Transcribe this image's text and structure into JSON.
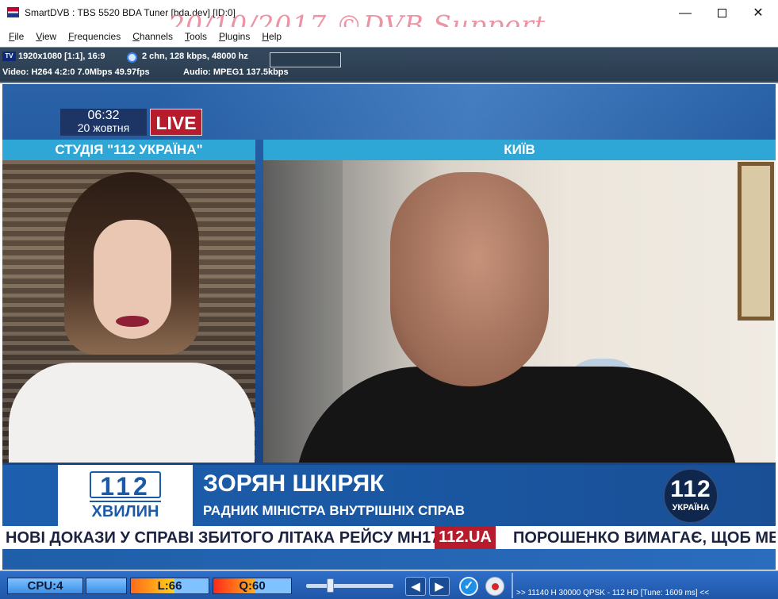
{
  "window": {
    "title": "SmartDVB : TBS 5520 BDA Tuner [bda.dev]  [ID:0]",
    "minimize": "—",
    "maximize": "",
    "close": "✕"
  },
  "watermark": "20/10/2017  ©DVB Support",
  "menu": [
    {
      "underline": "F",
      "rest": "ile"
    },
    {
      "underline": "V",
      "rest": "iew"
    },
    {
      "underline": "F",
      "rest": "requencies"
    },
    {
      "underline": "C",
      "rest": "hannels"
    },
    {
      "underline": "T",
      "rest": "ools"
    },
    {
      "underline": "P",
      "rest": "lugins"
    },
    {
      "underline": "H",
      "rest": "elp"
    }
  ],
  "info": {
    "tv_badge": "TV",
    "resolution": "1920x1080 [1:1], 16:9",
    "audio_summary": "2 chn, 128 kbps, 48000 hz",
    "video_line": "Video: H264  4:2:0  7.0Mbps  49.97fps",
    "audio_line": "Audio: MPEG1  137.5kbps"
  },
  "broadcast": {
    "clock_time": "06:32",
    "clock_date": "20 жовтня",
    "live": "LIVE",
    "studio_label": "СТУДІЯ \"112 УКРАЇНА\"",
    "kyiv_label": "КИЇВ",
    "logo_number": "112",
    "logo_word": "ХВИЛИН",
    "guest_name": "ЗОРЯН ШКІРЯК",
    "guest_title": "РАДНИК МІНІСТРА ВНУТРІШНІХ СПРАВ",
    "channel_number": "112",
    "channel_country": "УКРАЇНА",
    "ticker_left": "НОВІ ДОКАЗИ У СПРАВІ ЗБИТОГО ЛІТАКА РЕЙСУ МН17",
    "ticker_badge": "112.UA",
    "ticker_right": "ПОРОШЕНКО ВИМАГАЄ, ЩОБ МЕЩ"
  },
  "status": {
    "cpu": "CPU:4",
    "level": "L:66",
    "quality": "Q:60",
    "level_fraction": 0.66,
    "quality_fraction": 0.6,
    "tuner": ">> 11140 H 30000 QPSK - 112 HD [Tune: 1609 ms] <<"
  },
  "colors": {
    "accent_blue": "#1f56a8",
    "live_red": "#b71c2c",
    "header_cyan": "#2ea7d6"
  }
}
